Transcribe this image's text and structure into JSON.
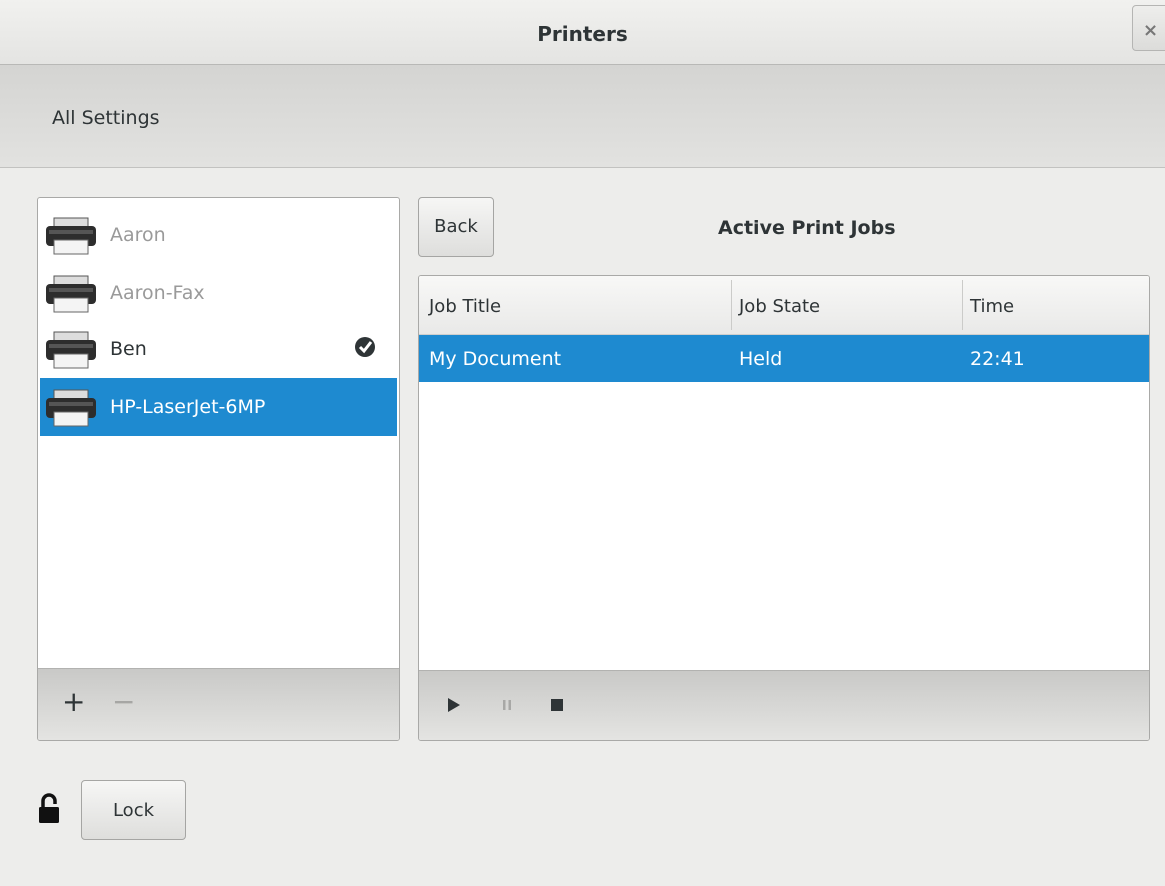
{
  "window": {
    "title": "Printers",
    "close_glyph": "×"
  },
  "header": {
    "all_settings_label": "All Settings"
  },
  "printers": [
    {
      "name": "Aaron",
      "enabled": false,
      "default": false,
      "selected": false,
      "icon": "printer-icon"
    },
    {
      "name": "Aaron-Fax",
      "enabled": false,
      "default": false,
      "selected": false,
      "icon": "printer-icon"
    },
    {
      "name": "Ben",
      "enabled": true,
      "default": true,
      "selected": false,
      "icon": "printer-icon"
    },
    {
      "name": "HP-LaserJet-6MP",
      "enabled": true,
      "default": false,
      "selected": true,
      "icon": "printer-icon"
    }
  ],
  "printer_toolbar": {
    "add_glyph": "+",
    "remove_glyph": "−"
  },
  "jobs": {
    "back_label": "Back",
    "title": "Active Print Jobs",
    "columns": [
      "Job Title",
      "Job State",
      "Time"
    ],
    "rows": [
      {
        "title": "My Document",
        "state": "Held",
        "time": "22:41",
        "selected": true
      }
    ],
    "toolbar_icons": [
      "play-icon",
      "pause-icon",
      "stop-icon"
    ]
  },
  "lock": {
    "label": "Lock",
    "icon": "lock-icon"
  },
  "colors": {
    "selection": "#1e8ad0",
    "window_bg": "#ededeb"
  }
}
